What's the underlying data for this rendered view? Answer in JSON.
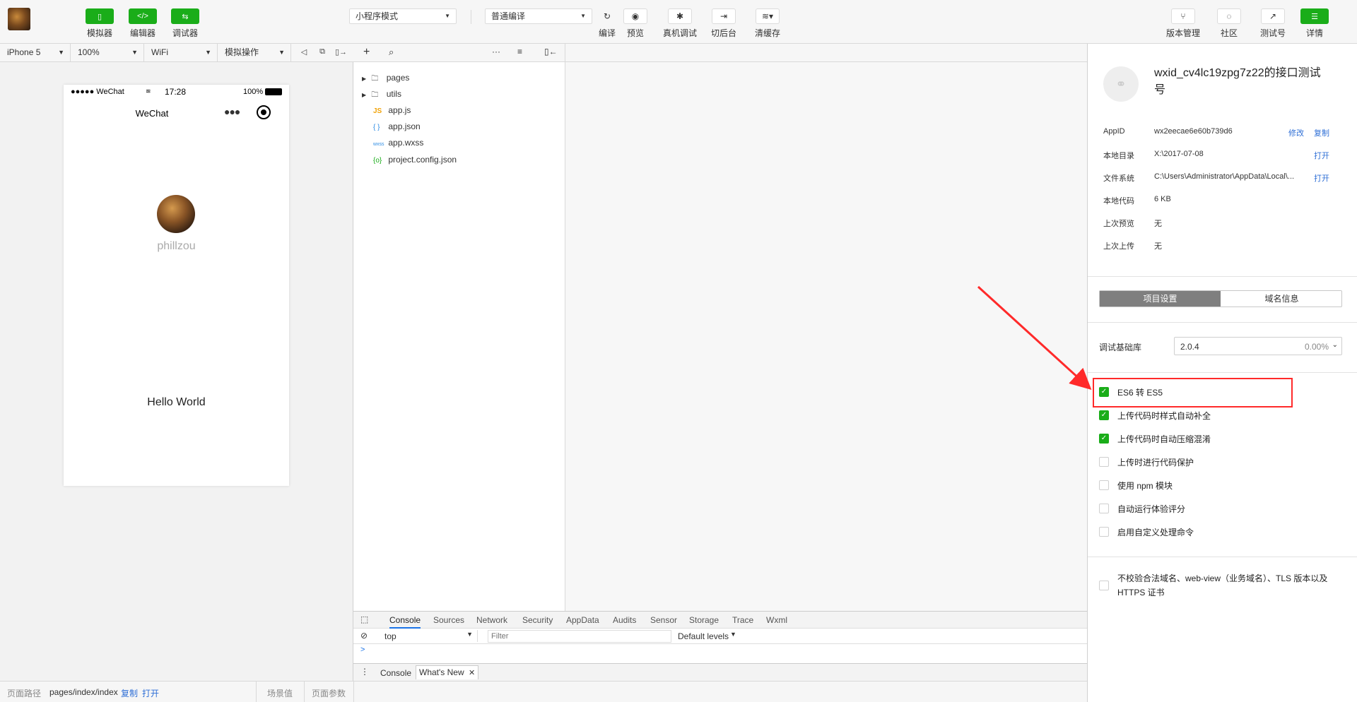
{
  "toolbar": {
    "left_buttons": [
      {
        "label": "模拟器",
        "icon": "phone-icon"
      },
      {
        "label": "编辑器",
        "icon": "code-icon"
      },
      {
        "label": "调试器",
        "icon": "debug-arrows-icon"
      }
    ],
    "mode_select": "小程序模式",
    "compile_select": "普通编译",
    "action_buttons": [
      {
        "label": "编译"
      },
      {
        "label": "预览"
      },
      {
        "label": "真机调试"
      },
      {
        "label": "切后台"
      },
      {
        "label": "清缓存"
      }
    ],
    "right_buttons": [
      {
        "label": "版本管理"
      },
      {
        "label": "社区"
      },
      {
        "label": "测试号"
      },
      {
        "label": "详情"
      }
    ],
    "accent_color": "#1aad19"
  },
  "simulator": {
    "device": "iPhone 5",
    "zoom": "100%",
    "network": "WiFi",
    "operation": "模拟操作",
    "phone": {
      "carrier": "●●●●● WeChat",
      "time": "17:28",
      "battery": "100%",
      "nav_title": "WeChat",
      "username": "phillzou",
      "hello": "Hello World"
    }
  },
  "files": {
    "items": [
      "pages",
      "utils",
      "app.js",
      "app.json",
      "app.wxss",
      "project.config.json"
    ],
    "icons": [
      "JS",
      "{ }",
      "wxss",
      "{o}"
    ]
  },
  "devtools": {
    "tabs": [
      "Console",
      "Sources",
      "Network",
      "Security",
      "AppData",
      "Audits",
      "Sensor",
      "Storage",
      "Trace",
      "Wxml"
    ],
    "context": "top",
    "filter_placeholder": "Filter",
    "levels": "Default levels",
    "prompt": ">",
    "drawer_tabs": [
      "Console",
      "What's New"
    ]
  },
  "statusbar": {
    "path_label": "页面路径",
    "path": "pages/index/index",
    "copy": "复制",
    "open": "打开",
    "scene": "场景值",
    "params": "页面参数"
  },
  "details": {
    "project_name": "wxid_cv4lc19zpg7z22的接口测试号",
    "info": [
      {
        "key": "AppID",
        "value": "wx2eecae6e60b739d6",
        "action1": "修改",
        "action2": "复制"
      },
      {
        "key": "本地目录",
        "value": "X:\\2017-07-08",
        "action2": "打开"
      },
      {
        "key": "文件系统",
        "value": "C:\\Users\\Administrator\\AppData\\Local\\...",
        "action2": "打开"
      },
      {
        "key": "本地代码",
        "value": "6 KB"
      },
      {
        "key": "上次预览",
        "value": "无"
      },
      {
        "key": "上次上传",
        "value": "无"
      }
    ],
    "tabs": [
      "项目设置",
      "域名信息"
    ],
    "lib_label": "调试基础库",
    "lib_version": "2.0.4",
    "lib_percent": "0.00%",
    "checkboxes": [
      {
        "label": "ES6 转 ES5",
        "checked": true
      },
      {
        "label": "上传代码时样式自动补全",
        "checked": true
      },
      {
        "label": "上传代码时自动压缩混淆",
        "checked": true
      },
      {
        "label": "上传时进行代码保护",
        "checked": false
      },
      {
        "label": "使用 npm 模块",
        "checked": false
      },
      {
        "label": "自动运行体验评分",
        "checked": false
      },
      {
        "label": "启用自定义处理命令",
        "checked": false
      }
    ],
    "tls_label": "不校验合法域名、web-view（业务域名）、TLS 版本以及 HTTPS 证书",
    "annotation_color": "#ff2a2a"
  }
}
